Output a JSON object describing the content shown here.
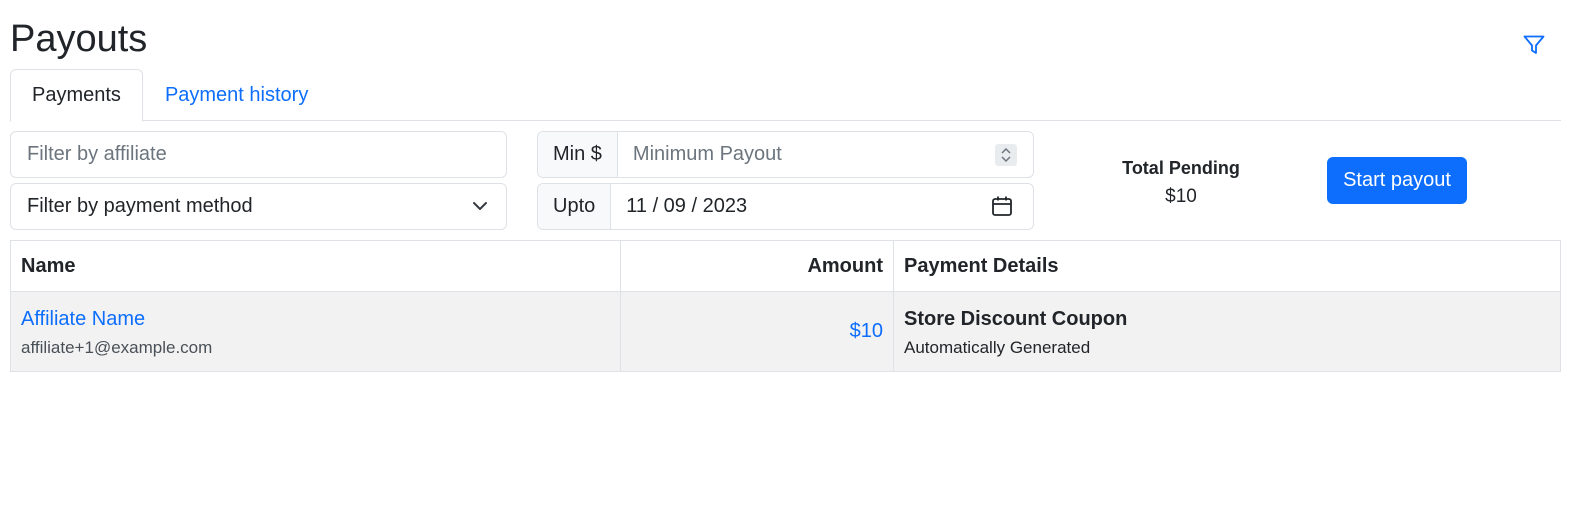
{
  "page": {
    "title": "Payouts"
  },
  "icons": {
    "filter": "filter-icon",
    "chevron": "chevron-down-icon",
    "calendar": "calendar-icon",
    "spinner": "number-spinner-icon"
  },
  "colors": {
    "primary": "#0d6efd",
    "border": "#dee2e6",
    "row_bg": "#f2f2f2"
  },
  "tabs": [
    {
      "label": "Payments",
      "active": true
    },
    {
      "label": "Payment history",
      "active": false
    }
  ],
  "filters": {
    "affiliate_placeholder": "Filter by affiliate",
    "payment_method_selected": "Filter by payment method",
    "min_addon": "Min $",
    "min_placeholder": "Minimum Payout",
    "upto_addon": "Upto",
    "upto_date": "11 / 09 / 2023"
  },
  "summary": {
    "total_label": "Total Pending",
    "total_value": "$10",
    "start_button": "Start payout"
  },
  "table": {
    "headers": [
      "Name",
      "Amount",
      "Payment Details"
    ],
    "rows": [
      {
        "name": "Affiliate Name",
        "email": "affiliate+1@example.com",
        "amount": "$10",
        "detail_title": "Store Discount Coupon",
        "detail_sub": "Automatically Generated"
      }
    ]
  }
}
